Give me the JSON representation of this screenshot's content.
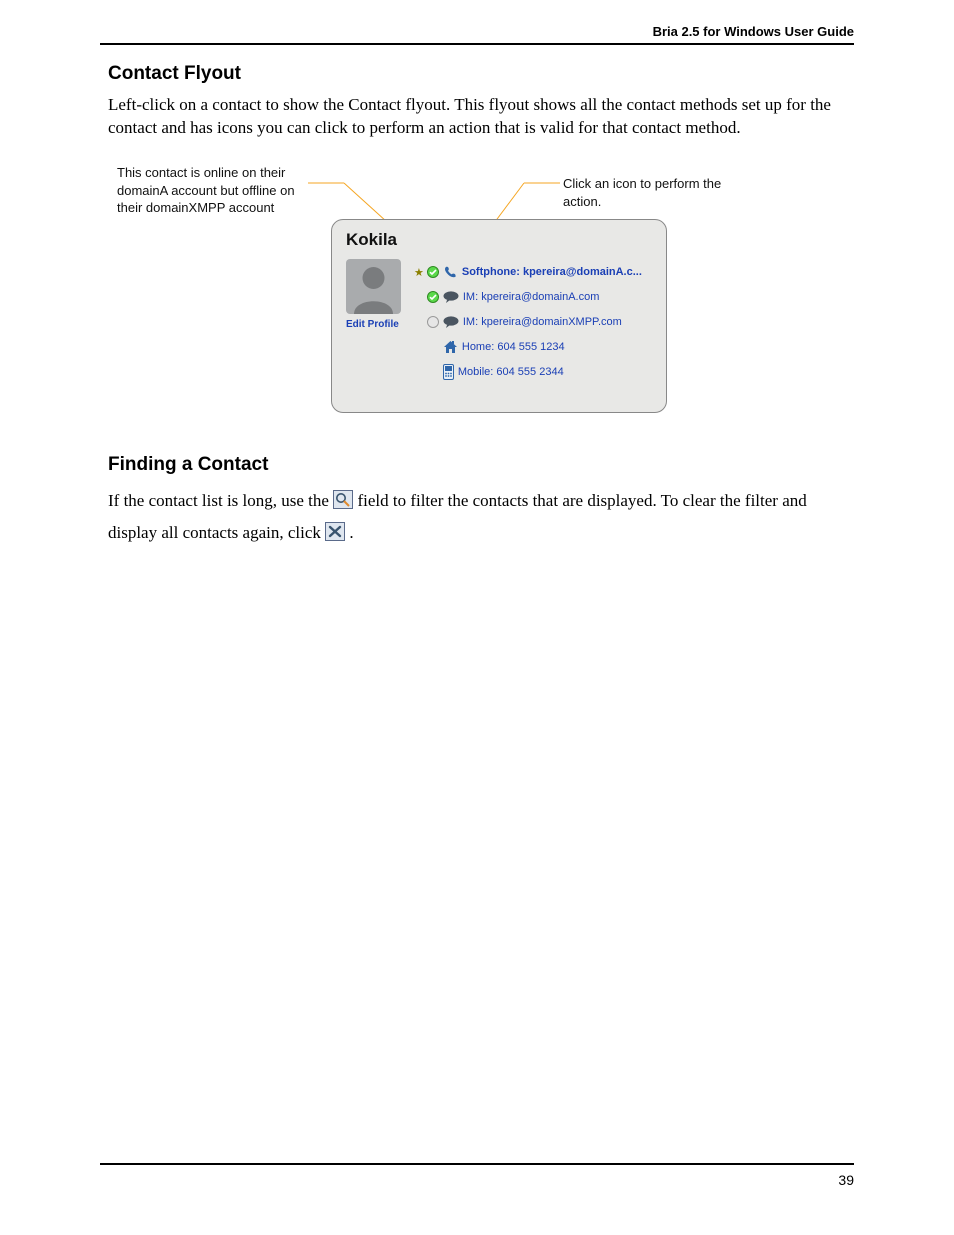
{
  "header": {
    "title": "Bria 2.5 for Windows User Guide"
  },
  "footer": {
    "page": "39"
  },
  "section1": {
    "heading": "Contact Flyout",
    "body": "Left-click on a contact to show the Contact flyout. This flyout shows all the contact methods set up for the contact and has icons you can click to perform an action that is valid for that contact method."
  },
  "callouts": {
    "left": "This contact is online on their domainA account but offline on their domainXMPP account",
    "right": "Click an icon to perform the action."
  },
  "flyout": {
    "name": "Kokila",
    "edit_profile_label": "Edit Profile",
    "rows": [
      {
        "is_default": true,
        "presence": "online",
        "icon": "phone",
        "label": "Softphone: kpereira@domainA.c...",
        "bold": true
      },
      {
        "is_default": false,
        "presence": "online",
        "icon": "bubble",
        "label": "IM: kpereira@domainA.com",
        "bold": false
      },
      {
        "is_default": false,
        "presence": "offline",
        "icon": "bubble",
        "label": "IM: kpereira@domainXMPP.com",
        "bold": false
      },
      {
        "is_default": false,
        "presence": null,
        "icon": "home",
        "label": "Home: 604 555 1234",
        "bold": false
      },
      {
        "is_default": false,
        "presence": null,
        "icon": "mobile",
        "label": "Mobile: 604 555 2344",
        "bold": false
      }
    ]
  },
  "section2": {
    "heading": "Finding a Contact",
    "body_pre": "If the contact list is long, use the ",
    "body_mid": " field to filter the contacts that are displayed. To clear the filter and display all contacts again, click ",
    "body_post": " ."
  }
}
